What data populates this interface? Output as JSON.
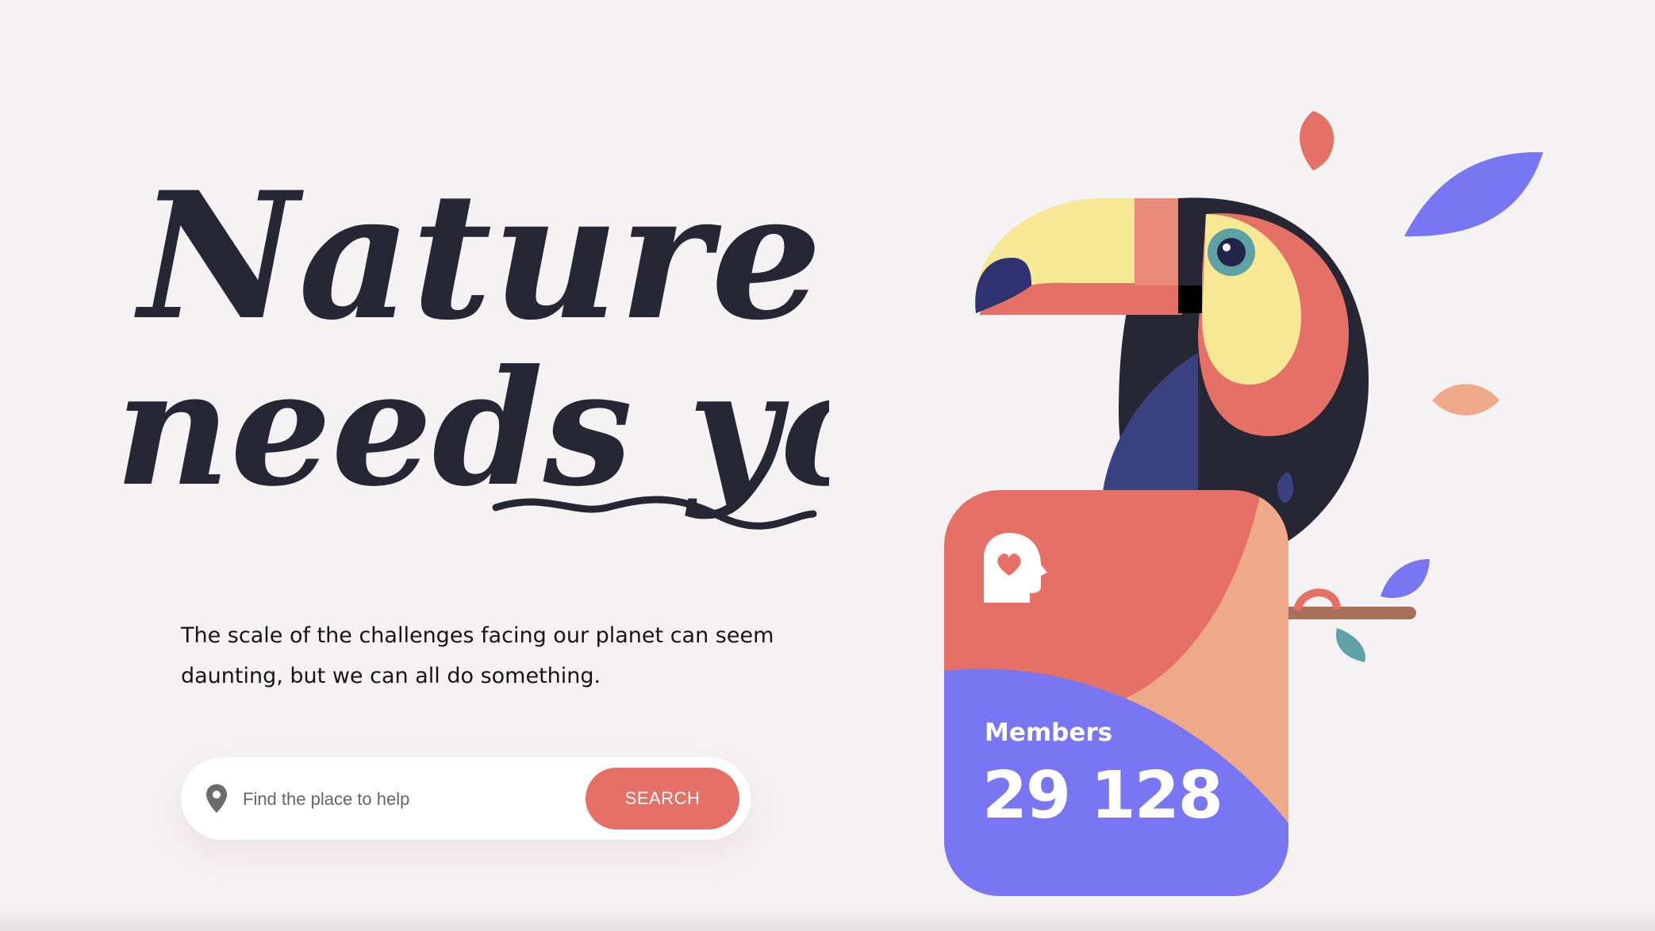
{
  "hero": {
    "title_line1": "Nature",
    "title_line2": "needs you",
    "tagline": "The scale of the challenges facing our planet can seem daunting, but we can all do something."
  },
  "search": {
    "placeholder": "Find the place to help",
    "button_label": "SEARCH",
    "icon": "location-pin-icon"
  },
  "members_card": {
    "icon": "head-heart-icon",
    "label": "Members",
    "count": "29 128"
  },
  "colors": {
    "background": "#f5f2f3",
    "accent_coral": "#e47066",
    "accent_purple": "#7876f2",
    "accent_peach": "#eeaa88",
    "accent_yellow": "#f7e896",
    "dark_navy": "#262634",
    "teal": "#5ea2a6"
  }
}
